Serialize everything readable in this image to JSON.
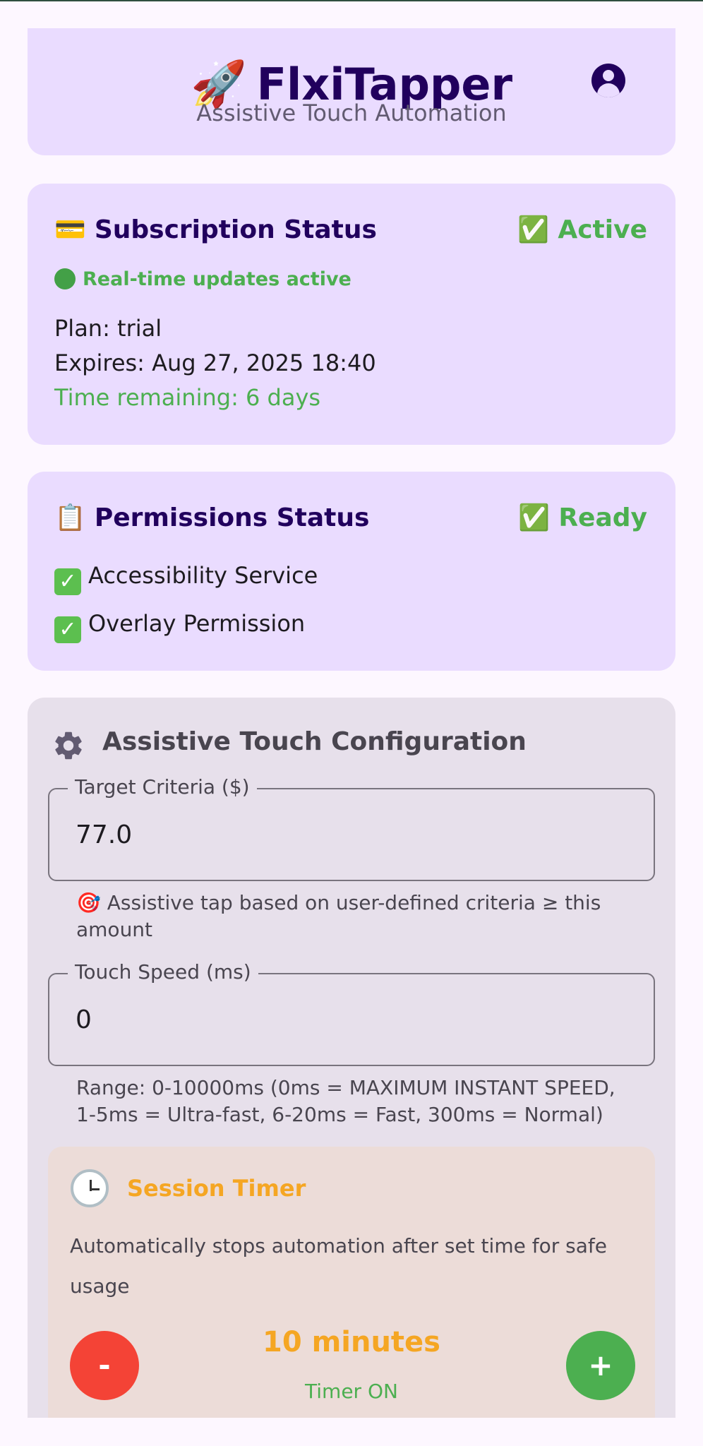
{
  "header": {
    "rocket_emoji": "🚀",
    "title": "FlxiTapper",
    "subtitle": "Assistive Touch Automation",
    "profile_icon": "account-circle-icon"
  },
  "subscription": {
    "emoji": "💳",
    "title": "Subscription Status",
    "badge": "✅ Active",
    "live_text": "Real-time updates active",
    "plan": "Plan: trial",
    "expires": "Expires: Aug 27, 2025 18:40",
    "remaining": "Time remaining: 6 days"
  },
  "permissions": {
    "emoji": "📋",
    "title": "Permissions Status",
    "badge": "✅ Ready",
    "items": [
      {
        "label": "Accessibility Service"
      },
      {
        "label": "Overlay Permission"
      }
    ]
  },
  "config": {
    "title": "Assistive Touch Configuration",
    "icon": "gear-icon",
    "target": {
      "label": "Target Criteria ($)",
      "value": "77.0",
      "helper": "🎯 Assistive tap based on user-defined criteria ≥ this amount"
    },
    "speed": {
      "label": "Touch Speed (ms)",
      "value": "0",
      "helper": "Range: 0-10000ms (0ms = MAXIMUM INSTANT SPEED, 1-5ms = Ultra-fast, 6-20ms = Fast, 300ms = Normal)"
    },
    "timer": {
      "title": "Session Timer",
      "description": "Automatically stops automation after set time for safe usage",
      "minus_label": "-",
      "plus_label": "+",
      "value": "10 minutes",
      "state": "Timer ON"
    }
  },
  "colors": {
    "accent_purple": "#21005d",
    "success_green": "#4caf50",
    "timer_orange": "#f5a623",
    "minus_red": "#f44336"
  }
}
